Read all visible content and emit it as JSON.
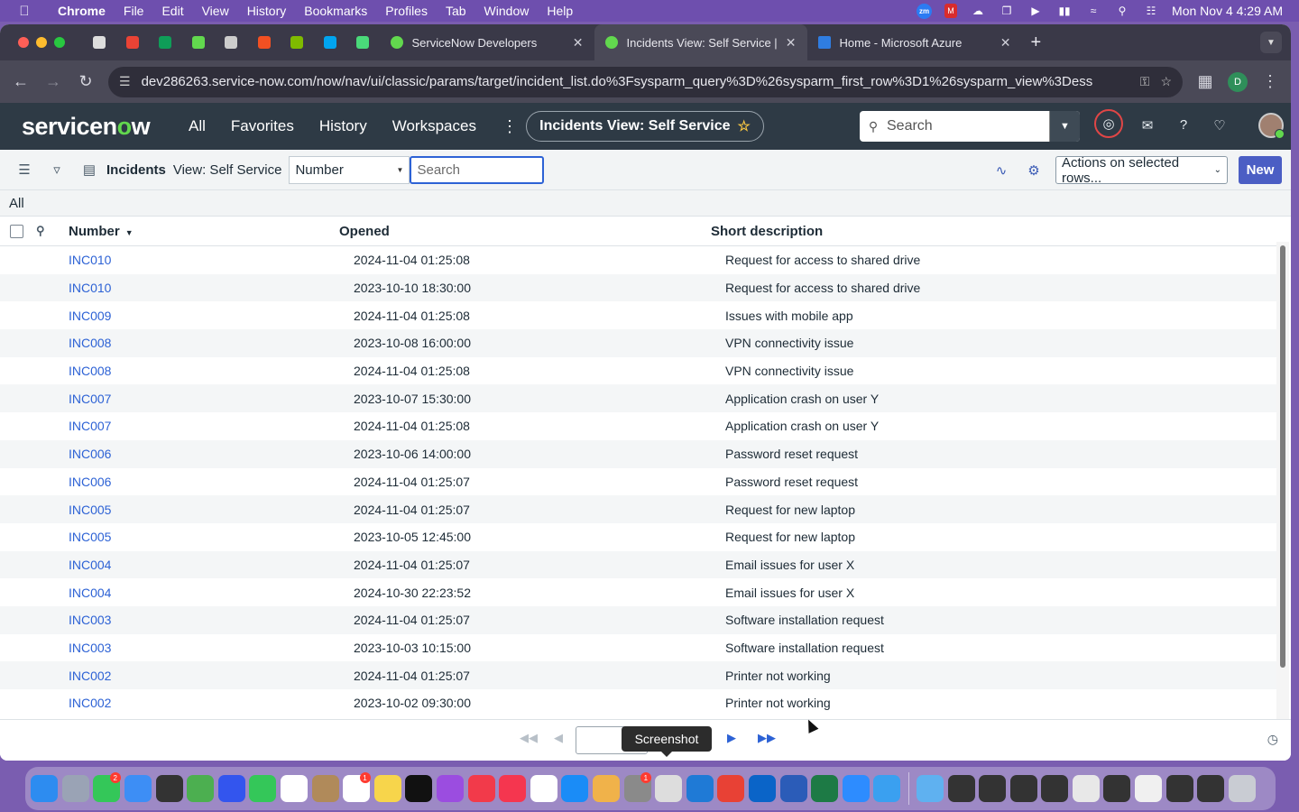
{
  "menubar": {
    "app": "Chrome",
    "items": [
      "File",
      "Edit",
      "View",
      "History",
      "Bookmarks",
      "Profiles",
      "Tab",
      "Window",
      "Help"
    ],
    "tray": [
      "zm"
    ],
    "clock": "Mon Nov 4  4:29 AM"
  },
  "tabs": [
    {
      "title": "ServiceNow Developers",
      "favicon_color": "#62d84e",
      "active": false
    },
    {
      "title": "Incidents View: Self Service | ",
      "favicon_color": "#62d84e",
      "active": true
    },
    {
      "title": "Home - Microsoft Azure",
      "favicon_color": "#2f7de1",
      "active": false
    }
  ],
  "pinned_tabs": [
    {
      "icon": "openai-icon",
      "color": "#dddddd"
    },
    {
      "icon": "gmail-icon",
      "color": "#ea4335"
    },
    {
      "icon": "sheets-icon",
      "color": "#0f9d58"
    },
    {
      "icon": "servicenow-icon",
      "color": "#62d84e"
    },
    {
      "icon": "drive-icon",
      "color": "#cccccc"
    },
    {
      "icon": "microsoft-icon",
      "color": "#f25022"
    },
    {
      "icon": "microsoft-icon",
      "color": "#7fba00"
    },
    {
      "icon": "microsoft-icon",
      "color": "#00a4ef"
    },
    {
      "icon": "perplexity-icon",
      "color": "#4ad97a"
    }
  ],
  "omnibox": {
    "url": "dev286263.service-now.com/now/nav/ui/classic/params/target/incident_list.do%3Fsysparm_query%3D%26sysparm_first_row%3D1%26sysparm_view%3Dess",
    "profile_initial": "D"
  },
  "sn": {
    "nav": [
      "All",
      "Favorites",
      "History",
      "Workspaces"
    ],
    "context_title": "Incidents View: Self Service",
    "search_placeholder": "Search"
  },
  "list": {
    "title": "Incidents",
    "view": "View: Self Service",
    "field": "Number",
    "search_placeholder": "Search",
    "actions": "Actions on selected rows...",
    "new_label": "New",
    "breadcrumb": "All",
    "columns": [
      "Number",
      "Opened",
      "Short description"
    ],
    "rows": [
      {
        "number": "INC010",
        "opened": "2024-11-04 01:25:08",
        "desc": "Request for access to shared drive"
      },
      {
        "number": "INC010",
        "opened": "2023-10-10 18:30:00",
        "desc": "Request for access to shared drive"
      },
      {
        "number": "INC009",
        "opened": "2024-11-04 01:25:08",
        "desc": "Issues with mobile app"
      },
      {
        "number": "INC008",
        "opened": "2023-10-08 16:00:00",
        "desc": "VPN connectivity issue"
      },
      {
        "number": "INC008",
        "opened": "2024-11-04 01:25:08",
        "desc": "VPN connectivity issue"
      },
      {
        "number": "INC007",
        "opened": "2023-10-07 15:30:00",
        "desc": "Application crash on user Y"
      },
      {
        "number": "INC007",
        "opened": "2024-11-04 01:25:08",
        "desc": "Application crash on user Y"
      },
      {
        "number": "INC006",
        "opened": "2023-10-06 14:00:00",
        "desc": "Password reset request"
      },
      {
        "number": "INC006",
        "opened": "2024-11-04 01:25:07",
        "desc": "Password reset request"
      },
      {
        "number": "INC005",
        "opened": "2024-11-04 01:25:07",
        "desc": "Request for new laptop"
      },
      {
        "number": "INC005",
        "opened": "2023-10-05 12:45:00",
        "desc": "Request for new laptop"
      },
      {
        "number": "INC004",
        "opened": "2024-11-04 01:25:07",
        "desc": "Email issues for user X"
      },
      {
        "number": "INC004",
        "opened": "2024-10-30 22:23:52",
        "desc": "Email issues for user X"
      },
      {
        "number": "INC003",
        "opened": "2024-11-04 01:25:07",
        "desc": "Software installation request"
      },
      {
        "number": "INC003",
        "opened": "2023-10-03 10:15:00",
        "desc": "Software installation request"
      },
      {
        "number": "INC002",
        "opened": "2024-11-04 01:25:07",
        "desc": "Printer not working"
      },
      {
        "number": "INC002",
        "opened": "2023-10-02 09:30:00",
        "desc": "Printer not working"
      }
    ]
  },
  "pager": {
    "tooltip": "Screenshot"
  },
  "dock": [
    {
      "icon": "finder-icon",
      "color": "#2d8cf0"
    },
    {
      "icon": "launchpad-icon",
      "color": "#9aa3b5"
    },
    {
      "icon": "messages-icon",
      "color": "#34c759",
      "badge": "2"
    },
    {
      "icon": "mail-icon",
      "color": "#3d8ef5"
    },
    {
      "icon": "pen-icon",
      "color": "#333333"
    },
    {
      "icon": "maps-icon",
      "color": "#4caf50"
    },
    {
      "icon": "azure-icon",
      "color": "#3355ee"
    },
    {
      "icon": "facetime-icon",
      "color": "#34c759"
    },
    {
      "icon": "calendar-icon",
      "color": "#ffffff"
    },
    {
      "icon": "contacts-icon",
      "color": "#b08a5a"
    },
    {
      "icon": "reminders-icon",
      "color": "#ffffff",
      "badge": "1"
    },
    {
      "icon": "notes-icon",
      "color": "#f7d54b"
    },
    {
      "icon": "tv-icon",
      "color": "#111111"
    },
    {
      "icon": "podcasts-icon",
      "color": "#9b4de0"
    },
    {
      "icon": "news-icon",
      "color": "#f23a4a"
    },
    {
      "icon": "music-icon",
      "color": "#f5364f"
    },
    {
      "icon": "notion-icon",
      "color": "#ffffff"
    },
    {
      "icon": "appstore-icon",
      "color": "#1a8cf7"
    },
    {
      "icon": "photos-icon",
      "color": "#f0b24a"
    },
    {
      "icon": "settings-icon",
      "color": "#8a8a8a",
      "badge": "1"
    },
    {
      "icon": "screenshot-icon",
      "color": "#dddddd"
    },
    {
      "icon": "vscode-icon",
      "color": "#1f7ad6"
    },
    {
      "icon": "chrome-icon",
      "color": "#e84135"
    },
    {
      "icon": "outlook-icon",
      "color": "#0a64c8"
    },
    {
      "icon": "word-icon",
      "color": "#2b5cb8"
    },
    {
      "icon": "excel-icon",
      "color": "#1d7a45"
    },
    {
      "icon": "zoom-icon",
      "color": "#2d8cff"
    },
    {
      "icon": "safari-icon",
      "color": "#3aa0f0"
    },
    {
      "icon": "folder-icon",
      "color": "#5fb1f0"
    },
    {
      "icon": "window-thumb-icon",
      "color": "#333333"
    },
    {
      "icon": "window-thumb-icon",
      "color": "#333333"
    },
    {
      "icon": "window-thumb-icon",
      "color": "#333333"
    },
    {
      "icon": "window-thumb-icon",
      "color": "#333333"
    },
    {
      "icon": "window-thumb-icon",
      "color": "#e8e8e8"
    },
    {
      "icon": "window-thumb-icon",
      "color": "#333333"
    },
    {
      "icon": "window-thumb-icon",
      "color": "#f0f0f0"
    },
    {
      "icon": "window-thumb-icon",
      "color": "#333333"
    },
    {
      "icon": "window-thumb-icon",
      "color": "#333333"
    },
    {
      "icon": "trash-icon",
      "color": "#c9ccd3"
    }
  ]
}
